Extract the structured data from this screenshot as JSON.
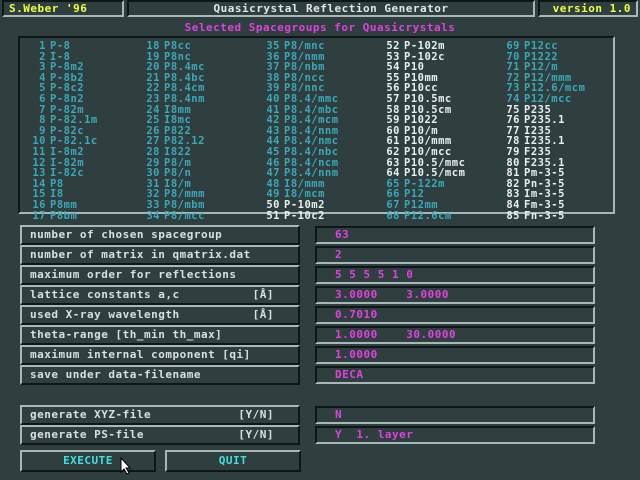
{
  "titlebar": {
    "author": "S.Weber '96",
    "title": "Quasicrystal Reflection Generator",
    "version": "version 1.0"
  },
  "spacegroups": {
    "heading": "Selected Spacegroups for Quasicrystals",
    "columns": [
      [
        {
          "n": "1",
          "name": "P-8",
          "color": "cyan"
        },
        {
          "n": "2",
          "name": "I-8",
          "color": "cyan"
        },
        {
          "n": "3",
          "name": "P-8m2",
          "color": "cyan"
        },
        {
          "n": "4",
          "name": "P-8b2",
          "color": "cyan"
        },
        {
          "n": "5",
          "name": "P-8c2",
          "color": "cyan"
        },
        {
          "n": "6",
          "name": "P-8n2",
          "color": "cyan"
        },
        {
          "n": "7",
          "name": "P-82m",
          "color": "cyan"
        },
        {
          "n": "8",
          "name": "P-82.1m",
          "color": "cyan"
        },
        {
          "n": "9",
          "name": "P-82c",
          "color": "cyan"
        },
        {
          "n": "10",
          "name": "P-82.1c",
          "color": "cyan"
        },
        {
          "n": "11",
          "name": "I-8m2",
          "color": "cyan"
        },
        {
          "n": "12",
          "name": "I-82m",
          "color": "cyan"
        },
        {
          "n": "13",
          "name": "I-82c",
          "color": "cyan"
        },
        {
          "n": "14",
          "name": "P8",
          "color": "cyan"
        },
        {
          "n": "15",
          "name": "I8",
          "color": "cyan"
        },
        {
          "n": "16",
          "name": "P8mm",
          "color": "cyan"
        },
        {
          "n": "17",
          "name": "P8bm",
          "color": "cyan"
        }
      ],
      [
        {
          "n": "18",
          "name": "P8cc",
          "color": "cyan"
        },
        {
          "n": "19",
          "name": "P8nc",
          "color": "cyan"
        },
        {
          "n": "20",
          "name": "P8.4mc",
          "color": "cyan"
        },
        {
          "n": "21",
          "name": "P8.4bc",
          "color": "cyan"
        },
        {
          "n": "22",
          "name": "P8.4cm",
          "color": "cyan"
        },
        {
          "n": "23",
          "name": "P8.4nm",
          "color": "cyan"
        },
        {
          "n": "24",
          "name": "I8mm",
          "color": "cyan"
        },
        {
          "n": "25",
          "name": "I8mc",
          "color": "cyan"
        },
        {
          "n": "26",
          "name": "P822",
          "color": "cyan"
        },
        {
          "n": "27",
          "name": "P82.12",
          "color": "cyan"
        },
        {
          "n": "28",
          "name": "I822",
          "color": "cyan"
        },
        {
          "n": "29",
          "name": "P8/m",
          "color": "cyan"
        },
        {
          "n": "30",
          "name": "P8/n",
          "color": "cyan"
        },
        {
          "n": "31",
          "name": "I8/m",
          "color": "cyan"
        },
        {
          "n": "32",
          "name": "P8/mmm",
          "color": "cyan"
        },
        {
          "n": "33",
          "name": "P8/mbm",
          "color": "cyan"
        },
        {
          "n": "34",
          "name": "P8/mcc",
          "color": "cyan"
        }
      ],
      [
        {
          "n": "35",
          "name": "P8/mnc",
          "color": "cyan"
        },
        {
          "n": "36",
          "name": "P8/nmm",
          "color": "cyan"
        },
        {
          "n": "37",
          "name": "P8/nbm",
          "color": "cyan"
        },
        {
          "n": "38",
          "name": "P8/ncc",
          "color": "cyan"
        },
        {
          "n": "39",
          "name": "P8/nnc",
          "color": "cyan"
        },
        {
          "n": "40",
          "name": "P8.4/mmc",
          "color": "cyan"
        },
        {
          "n": "41",
          "name": "P8.4/mbc",
          "color": "cyan"
        },
        {
          "n": "42",
          "name": "P8.4/mcm",
          "color": "cyan"
        },
        {
          "n": "43",
          "name": "P8.4/nnm",
          "color": "cyan"
        },
        {
          "n": "44",
          "name": "P8.4/nmc",
          "color": "cyan"
        },
        {
          "n": "45",
          "name": "P8.4/nbc",
          "color": "cyan"
        },
        {
          "n": "46",
          "name": "P8.4/ncm",
          "color": "cyan"
        },
        {
          "n": "47",
          "name": "P8.4/nnm",
          "color": "cyan"
        },
        {
          "n": "48",
          "name": "I8/mmm",
          "color": "cyan"
        },
        {
          "n": "49",
          "name": "I8/mcm",
          "color": "cyan"
        },
        {
          "n": "50",
          "name": "P-10m2",
          "color": "white"
        },
        {
          "n": "51",
          "name": "P-10c2",
          "color": "white"
        }
      ],
      [
        {
          "n": "52",
          "name": "P-102m",
          "color": "white"
        },
        {
          "n": "53",
          "name": "P-102c",
          "color": "white"
        },
        {
          "n": "54",
          "name": "P10",
          "color": "white"
        },
        {
          "n": "55",
          "name": "P10mm",
          "color": "white"
        },
        {
          "n": "56",
          "name": "P10cc",
          "color": "white"
        },
        {
          "n": "57",
          "name": "P10.5mc",
          "color": "white"
        },
        {
          "n": "58",
          "name": "P10.5cm",
          "color": "white"
        },
        {
          "n": "59",
          "name": "P1022",
          "color": "white"
        },
        {
          "n": "60",
          "name": "P10/m",
          "color": "white"
        },
        {
          "n": "61",
          "name": "P10/mmm",
          "color": "white"
        },
        {
          "n": "62",
          "name": "P10/mcc",
          "color": "white"
        },
        {
          "n": "63",
          "name": "P10.5/mmc",
          "color": "white"
        },
        {
          "n": "64",
          "name": "P10.5/mcm",
          "color": "white"
        },
        {
          "n": "65",
          "name": "P-122m",
          "color": "cyan"
        },
        {
          "n": "66",
          "name": "P12",
          "color": "cyan"
        },
        {
          "n": "67",
          "name": "P12mm",
          "color": "cyan"
        },
        {
          "n": "68",
          "name": "P12.6cm",
          "color": "cyan"
        }
      ],
      [
        {
          "n": "69",
          "name": "P12cc",
          "color": "cyan"
        },
        {
          "n": "70",
          "name": "P1222",
          "color": "cyan"
        },
        {
          "n": "71",
          "name": "P12/m",
          "color": "cyan"
        },
        {
          "n": "72",
          "name": "P12/mmm",
          "color": "cyan"
        },
        {
          "n": "73",
          "name": "P12.6/mcm",
          "color": "cyan"
        },
        {
          "n": "74",
          "name": "P12/mcc",
          "color": "cyan"
        },
        {
          "n": "75",
          "name": "P235",
          "color": "white"
        },
        {
          "n": "76",
          "name": "P235.1",
          "color": "white"
        },
        {
          "n": "77",
          "name": "I235",
          "color": "white"
        },
        {
          "n": "78",
          "name": "I235.1",
          "color": "white"
        },
        {
          "n": "79",
          "name": "F235",
          "color": "white"
        },
        {
          "n": "80",
          "name": "F235.1",
          "color": "white"
        },
        {
          "n": "81",
          "name": "Pm-3-5",
          "color": "white"
        },
        {
          "n": "82",
          "name": "Pn-3-5",
          "color": "white"
        },
        {
          "n": "83",
          "name": "Im-3-5",
          "color": "white"
        },
        {
          "n": "84",
          "name": "Fm-3-5",
          "color": "white"
        },
        {
          "n": "85",
          "name": "Fn-3-5",
          "color": "white"
        }
      ]
    ]
  },
  "params": [
    {
      "label": "number of chosen spacegroup",
      "unit": "",
      "value": "63"
    },
    {
      "label": "number of matrix in qmatrix.dat",
      "unit": "",
      "value": "2"
    },
    {
      "label": "maximum order for reflections",
      "unit": "",
      "value": "5 5 5 5 1 0"
    },
    {
      "label": "lattice constants  a,c",
      "unit": "[Å]",
      "value": "3.0000    3.0000"
    },
    {
      "label": "used X-ray wavelength",
      "unit": "[Å]",
      "value": "0.7010"
    },
    {
      "label": "theta-range    [th_min  th_max]",
      "unit": "",
      "value": "1.0000    30.0000"
    },
    {
      "label": "maximum internal component [qi]",
      "unit": "",
      "value": "1.0000"
    },
    {
      "label": "save under data-filename",
      "unit": "",
      "value": "DECA"
    }
  ],
  "output_options": [
    {
      "label": "generate XYZ-file",
      "unit": "[Y/N]",
      "value": "N"
    },
    {
      "label": "generate PS-file",
      "unit": "[Y/N]",
      "value": "Y  1. layer"
    }
  ],
  "buttons": {
    "execute": "EXECUTE",
    "quit": "QUIT"
  },
  "colors": {
    "background": "#2f3f3f",
    "accent_magenta": "#e040e0",
    "accent_cyan": "#40e0e0",
    "title_yellow": "#f0ff40"
  }
}
